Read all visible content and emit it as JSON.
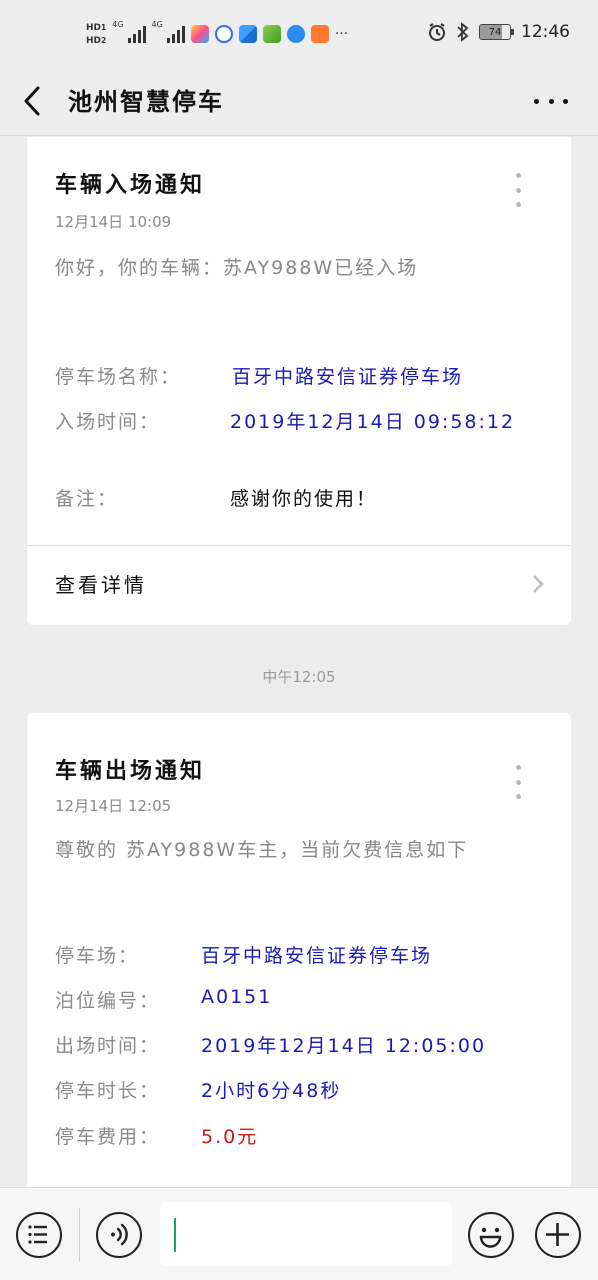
{
  "status_bar": {
    "hd1": "HD",
    "hd1_sub": "1",
    "hd2": "HD",
    "hd2_sub": "2",
    "net1": "4G",
    "net2": "4G",
    "overflow": "···",
    "battery": "74",
    "time": "12:46"
  },
  "header": {
    "title": "池州智慧停车"
  },
  "messages": [
    {
      "title": "车辆入场通知",
      "date": "12月14日  10:09",
      "intro": "你好，你的车辆：苏AY988W已经入场",
      "fields": [
        {
          "label": "停车场名称：",
          "value": "百牙中路安信证券停车场"
        },
        {
          "label": "入场时间：",
          "value": "2019年12月14日  09:58:12"
        },
        {
          "label": "备注：",
          "value": "感谢你的使用！"
        }
      ],
      "detail_label": "查看详情"
    },
    {
      "title": "车辆出场通知",
      "date": "12月14日  12:05",
      "intro": "尊敬的 苏AY988W车主，当前欠费信息如下",
      "fields": [
        {
          "label": "停车场：",
          "value": "百牙中路安信证券停车场"
        },
        {
          "label": "泊位编号：",
          "value": "A0151"
        },
        {
          "label": "出场时间：",
          "value": "2019年12月14日  12:05:00"
        },
        {
          "label": "停车时长：",
          "value": "2小时6分48秒"
        },
        {
          "label": "停车费用：",
          "value": "5.0元"
        }
      ]
    }
  ],
  "time_separator": "中午12:05",
  "colors": {
    "value_blue": "#1a1ab4",
    "fee_red": "#c81818",
    "caret_green": "#1aa260"
  }
}
